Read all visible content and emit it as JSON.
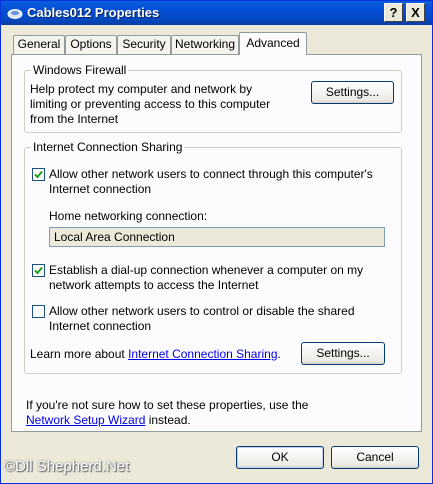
{
  "window": {
    "title": "Cables012 Properties"
  },
  "titlebar_buttons": {
    "help": "?",
    "close": "X"
  },
  "tabs": [
    {
      "label": "General"
    },
    {
      "label": "Options"
    },
    {
      "label": "Security"
    },
    {
      "label": "Networking"
    },
    {
      "label": "Advanced"
    }
  ],
  "firewall": {
    "group_label": "Windows Firewall",
    "description_lines": [
      "Help protect my computer and network by",
      "limiting or preventing access to this computer",
      "from the Internet"
    ],
    "settings_button": "Settings..."
  },
  "ics": {
    "group_label": "Internet Connection Sharing",
    "allow_share": {
      "checked": true,
      "lines": [
        "Allow other network users to connect through this computer's",
        "Internet connection"
      ]
    },
    "home_net_label": "Home networking connection:",
    "home_net_value": "Local Area Connection",
    "dialup": {
      "checked": true,
      "lines": [
        "Establish a dial-up connection whenever a computer on my",
        "network attempts to access the Internet"
      ]
    },
    "allow_control": {
      "checked": false,
      "lines": [
        "Allow other network users to control or disable the shared",
        "Internet connection"
      ]
    },
    "learn_more_prefix": "Learn more about ",
    "learn_more_link": "Internet Connection Sharing",
    "learn_more_suffix": ".",
    "settings_button": "Settings..."
  },
  "footer": {
    "line1": "If you're not sure how to set these properties, use the",
    "wizard_link": "Network Setup Wizard",
    "line2_suffix": " instead."
  },
  "buttons": {
    "ok": "OK",
    "cancel": "Cancel"
  },
  "watermark": "©Dll Shepherd.Net"
}
